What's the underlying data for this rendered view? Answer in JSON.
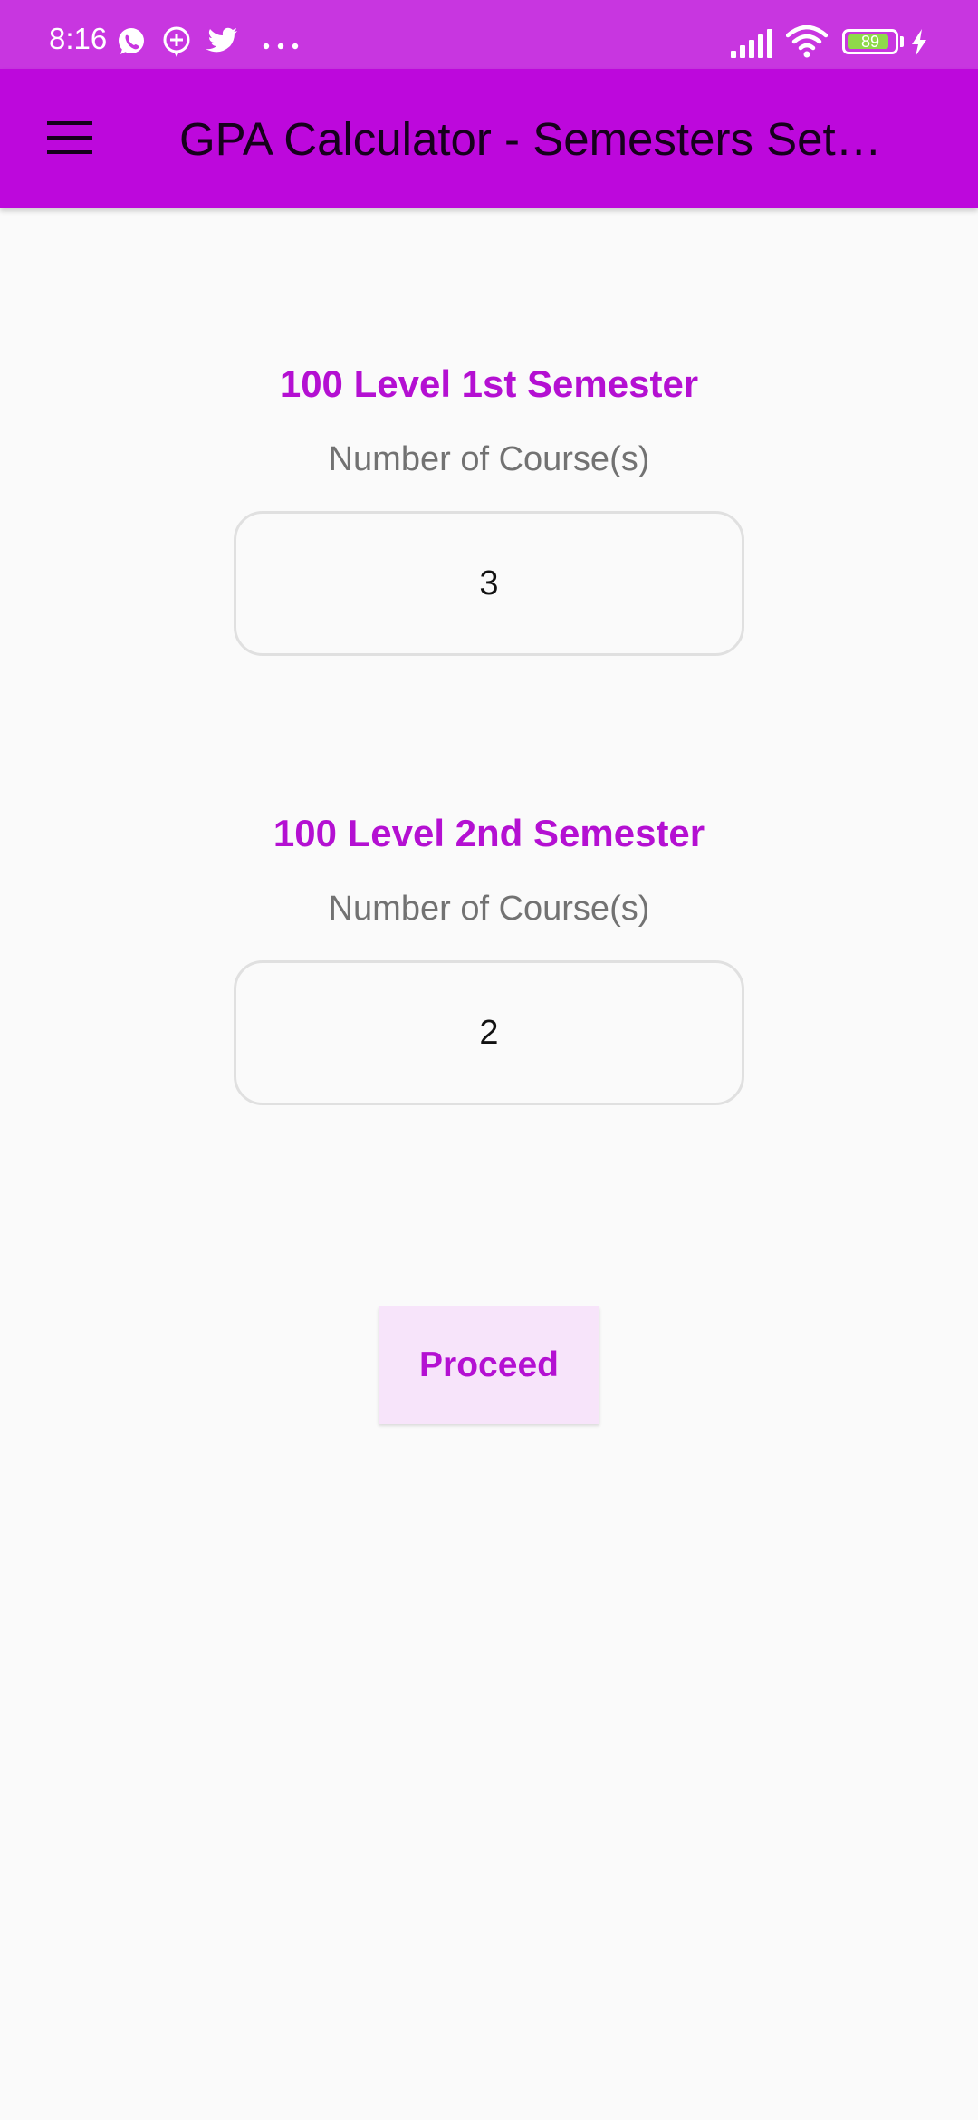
{
  "status_bar": {
    "time": "8:16",
    "notification_icons": [
      "whatsapp-icon",
      "message-plus-icon",
      "twitter-icon",
      "more-dots-icon"
    ],
    "system_icons": [
      "signal-icon",
      "wifi-icon",
      "battery-icon",
      "charging-icon"
    ],
    "battery_level": "89",
    "battery_fraction": 0.89
  },
  "app_bar": {
    "menu_icon": "hamburger-menu-icon",
    "title": "GPA Calculator - Semesters Set…"
  },
  "semesters": [
    {
      "title": "100 Level 1st Semester",
      "label": "Number of Course(s)",
      "value": "3"
    },
    {
      "title": "100 Level 2nd Semester",
      "label": "Number of Course(s)",
      "value": "2"
    }
  ],
  "actions": {
    "proceed_label": "Proceed"
  },
  "colors": {
    "status_bar": "#c836e0",
    "app_bar": "#bd08dc",
    "accent_text": "#b410d2",
    "button_bg": "#f7e4fa",
    "page_bg": "#fafafa"
  }
}
